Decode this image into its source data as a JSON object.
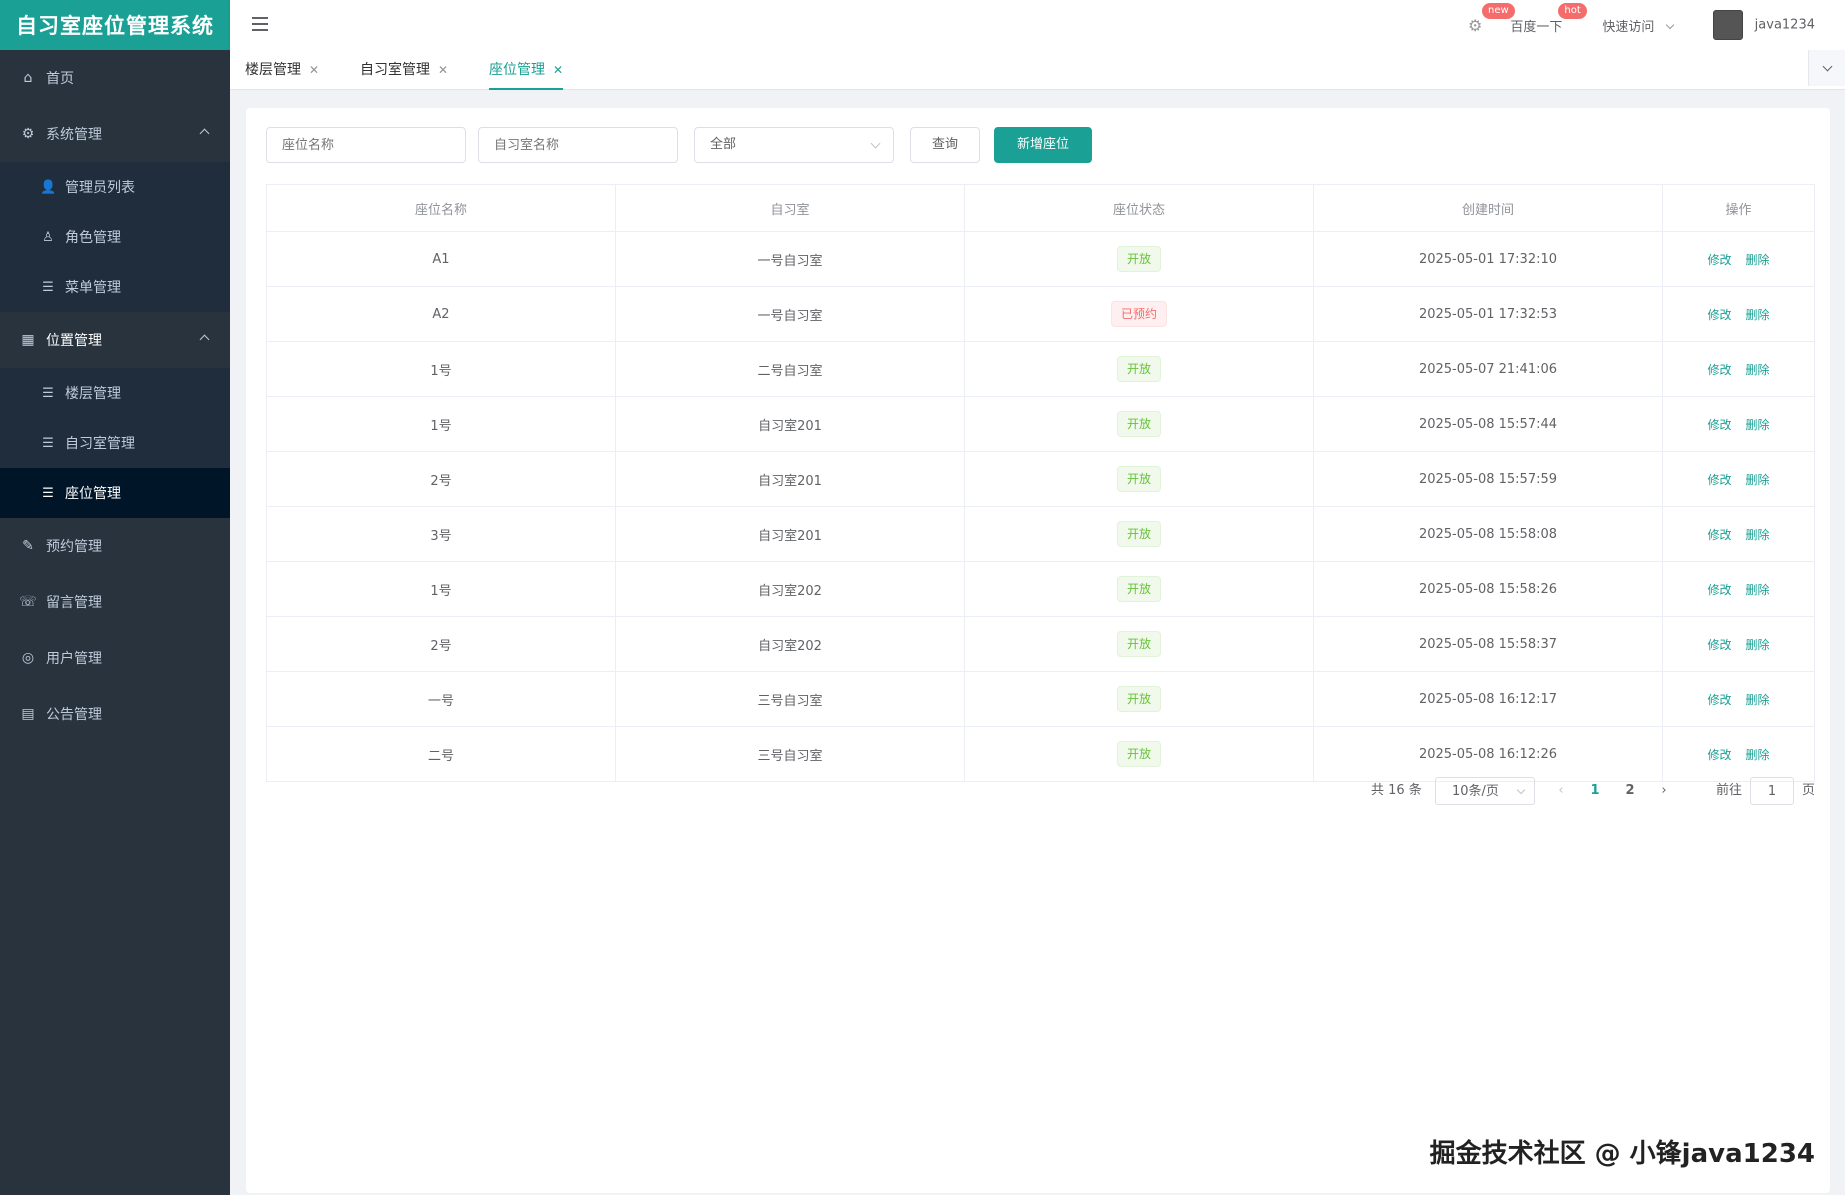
{
  "app": {
    "title": "自习室座位管理系统"
  },
  "sidebar": {
    "home": "首页",
    "system": {
      "label": "系统管理",
      "items": [
        "管理员列表",
        "角色管理",
        "菜单管理"
      ]
    },
    "location": {
      "label": "位置管理",
      "items": [
        "楼层管理",
        "自习室管理",
        "座位管理"
      ]
    },
    "others": [
      "预约管理",
      "留言管理",
      "用户管理",
      "公告管理"
    ]
  },
  "header": {
    "baidu": "百度一下",
    "baidu_badge": "hot",
    "settings_badge": "new",
    "quick_access": "快速访问",
    "username": "java1234"
  },
  "tabs": [
    {
      "label": "楼层管理",
      "active": false
    },
    {
      "label": "自习室管理",
      "active": false
    },
    {
      "label": "座位管理",
      "active": true
    }
  ],
  "filters": {
    "seat_name_placeholder": "座位名称",
    "room_name_placeholder": "自习室名称",
    "status_selected": "全部",
    "query_button": "查询",
    "add_button": "新增座位"
  },
  "table": {
    "headers": [
      "座位名称",
      "自习室",
      "座位状态",
      "创建时间",
      "操作"
    ],
    "rows": [
      {
        "name": "A1",
        "room": "一号自习室",
        "status": "开放",
        "status_type": "open",
        "created": "2025-05-01 17:32:10"
      },
      {
        "name": "A2",
        "room": "一号自习室",
        "status": "已预约",
        "status_type": "booked",
        "created": "2025-05-01 17:32:53"
      },
      {
        "name": "1号",
        "room": "二号自习室",
        "status": "开放",
        "status_type": "open",
        "created": "2025-05-07 21:41:06"
      },
      {
        "name": "1号",
        "room": "自习室201",
        "status": "开放",
        "status_type": "open",
        "created": "2025-05-08 15:57:44"
      },
      {
        "name": "2号",
        "room": "自习室201",
        "status": "开放",
        "status_type": "open",
        "created": "2025-05-08 15:57:59"
      },
      {
        "name": "3号",
        "room": "自习室201",
        "status": "开放",
        "status_type": "open",
        "created": "2025-05-08 15:58:08"
      },
      {
        "name": "1号",
        "room": "自习室202",
        "status": "开放",
        "status_type": "open",
        "created": "2025-05-08 15:58:26"
      },
      {
        "name": "2号",
        "room": "自习室202",
        "status": "开放",
        "status_type": "open",
        "created": "2025-05-08 15:58:37"
      },
      {
        "name": "一号",
        "room": "三号自习室",
        "status": "开放",
        "status_type": "open",
        "created": "2025-05-08 16:12:17"
      },
      {
        "name": "二号",
        "room": "三号自习室",
        "status": "开放",
        "status_type": "open",
        "created": "2025-05-08 16:12:26"
      }
    ],
    "edit_label": "修改",
    "delete_label": "删除"
  },
  "pagination": {
    "total_text": "共 16 条",
    "page_size": "10条/页",
    "pages": [
      "1",
      "2"
    ],
    "current_page": "1",
    "goto_prefix": "前往",
    "goto_value": "1",
    "goto_suffix": "页"
  },
  "watermark": "掘金技术社区 @ 小锋java1234",
  "colors": {
    "accent": "#1aa094",
    "sidebar_bg": "#28333e",
    "open": "#67c23a",
    "booked": "#f56c6c"
  }
}
